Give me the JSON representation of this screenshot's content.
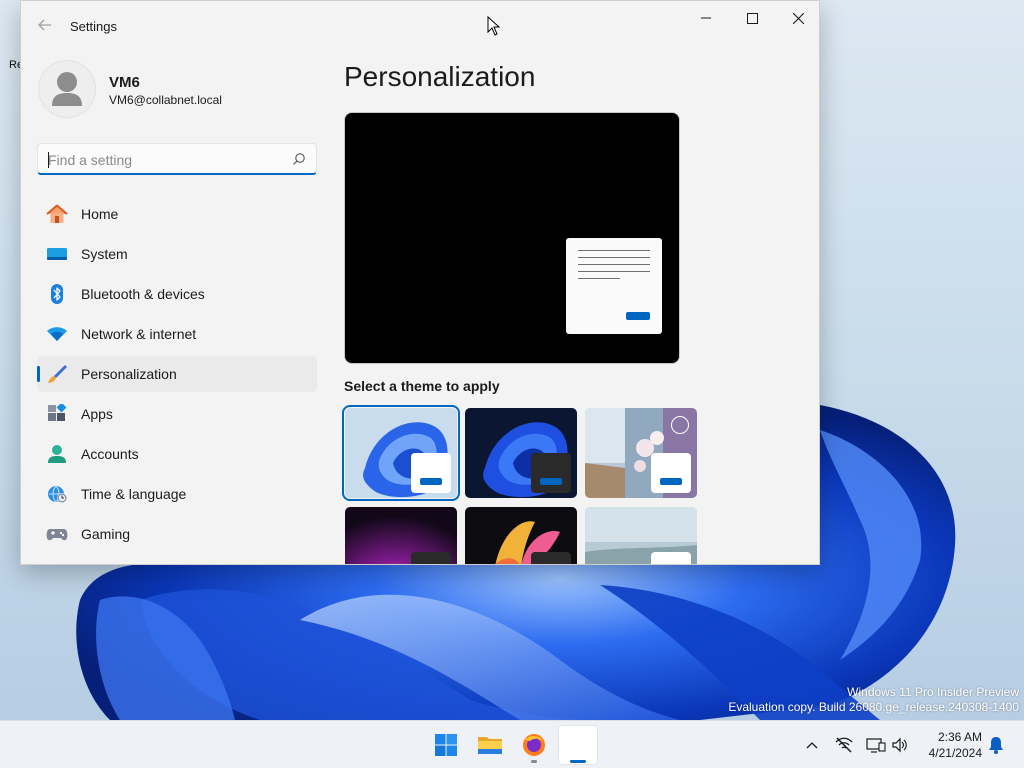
{
  "desktop": {
    "edge_label": "Re",
    "watermark_line1": "Windows 11 Pro Insider Preview",
    "watermark_line2": "Evaluation copy. Build 26080.ge_release.240308-1400"
  },
  "window": {
    "title": "Settings",
    "back_icon": "back-arrow-icon",
    "controls": [
      "minimize",
      "maximize",
      "close"
    ]
  },
  "profile": {
    "name": "VM6",
    "email": "VM6@collabnet.local"
  },
  "search": {
    "placeholder": "Find a setting",
    "value": ""
  },
  "nav": {
    "items": [
      {
        "label": "Home",
        "icon": "home-icon"
      },
      {
        "label": "System",
        "icon": "system-icon"
      },
      {
        "label": "Bluetooth & devices",
        "icon": "bluetooth-icon"
      },
      {
        "label": "Network & internet",
        "icon": "wifi-icon"
      },
      {
        "label": "Personalization",
        "icon": "brush-icon",
        "selected": true
      },
      {
        "label": "Apps",
        "icon": "apps-icon"
      },
      {
        "label": "Accounts",
        "icon": "accounts-icon"
      },
      {
        "label": "Time & language",
        "icon": "globe-clock-icon"
      },
      {
        "label": "Gaming",
        "icon": "gamepad-icon"
      }
    ]
  },
  "main": {
    "title": "Personalization",
    "section_label": "Select a theme to apply",
    "themes": [
      {
        "id": "windows-light",
        "selected": true
      },
      {
        "id": "windows-dark"
      },
      {
        "id": "spotlight"
      },
      {
        "id": "glow"
      },
      {
        "id": "captured-motion"
      },
      {
        "id": "flow"
      }
    ]
  },
  "taskbar": {
    "apps": [
      "start-icon",
      "file-explorer-icon",
      "firefox-icon",
      "settings-app-icon"
    ],
    "tray": [
      "chevron-up-icon",
      "network-off-icon",
      "display-icon",
      "volume-icon",
      "notification-bell-icon"
    ],
    "time": "2:36 AM",
    "date": "4/21/2024"
  },
  "colors": {
    "accent": "#0067c0",
    "window_bg": "#f3f3f3",
    "taskbar_bg": "#eef1f5"
  }
}
